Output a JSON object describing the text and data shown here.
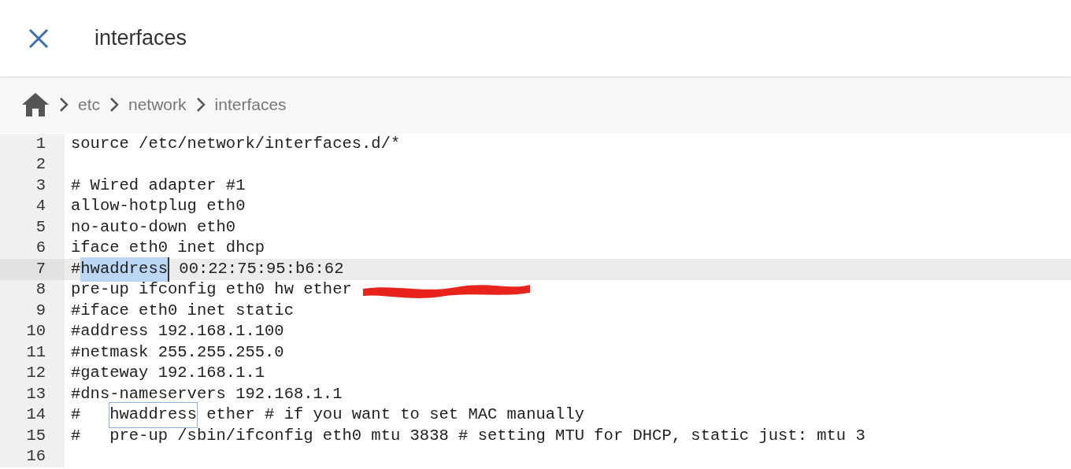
{
  "header": {
    "title": "interfaces"
  },
  "breadcrumb": [
    "etc",
    "network",
    "interfaces"
  ],
  "lines": [
    {
      "number": "1",
      "current": false,
      "segments": [
        {
          "kind": "text",
          "text": "source /etc/network/interfaces.d/*"
        }
      ]
    },
    {
      "number": "2",
      "current": false
    },
    {
      "number": "3",
      "current": false,
      "segments": [
        {
          "kind": "text",
          "text": "# Wired adapter #1"
        }
      ]
    },
    {
      "number": "4",
      "current": false,
      "segments": [
        {
          "kind": "text",
          "text": "allow-hotplug eth0"
        }
      ]
    },
    {
      "number": "5",
      "current": false,
      "segments": [
        {
          "kind": "text",
          "text": "no-auto-down eth0"
        }
      ]
    },
    {
      "number": "6",
      "current": false,
      "segments": [
        {
          "kind": "text",
          "text": "iface eth0 inet dhcp"
        }
      ]
    },
    {
      "number": "7",
      "current": true,
      "segments": [
        {
          "kind": "text",
          "text": "#"
        },
        {
          "kind": "selection",
          "text": "hwaddress"
        },
        {
          "kind": "text",
          "text": " 00:22:75:95:b6:62"
        }
      ]
    },
    {
      "number": "8",
      "current": false,
      "segments": [
        {
          "kind": "text",
          "text": "pre-up ifconfig eth0 hw ether "
        },
        {
          "kind": "redaction"
        }
      ]
    },
    {
      "number": "9",
      "current": false,
      "segments": [
        {
          "kind": "text",
          "text": "#iface eth0 inet static"
        }
      ]
    },
    {
      "number": "10",
      "current": false,
      "segments": [
        {
          "kind": "text",
          "text": "#address 192.168.1.100"
        }
      ]
    },
    {
      "number": "11",
      "current": false,
      "segments": [
        {
          "kind": "text",
          "text": "#netmask 255.255.255.0"
        }
      ]
    },
    {
      "number": "12",
      "current": false,
      "segments": [
        {
          "kind": "text",
          "text": "#gateway 192.168.1.1"
        }
      ]
    },
    {
      "number": "13",
      "current": false,
      "segments": [
        {
          "kind": "text",
          "text": "#dns-nameservers 192.168.1.1"
        }
      ]
    },
    {
      "number": "14",
      "current": false,
      "segments": [
        {
          "kind": "text",
          "text": "#   "
        },
        {
          "kind": "match",
          "text": "hwaddress"
        },
        {
          "kind": "text",
          "text": " ether # if you want to set MAC manually"
        }
      ]
    },
    {
      "number": "15",
      "current": false,
      "segments": [
        {
          "kind": "text",
          "text": "#   pre-up /sbin/ifconfig eth0 mtu 3838 # setting MTU for DHCP, static just: mtu 3"
        }
      ]
    },
    {
      "number": "16",
      "current": false
    }
  ]
}
